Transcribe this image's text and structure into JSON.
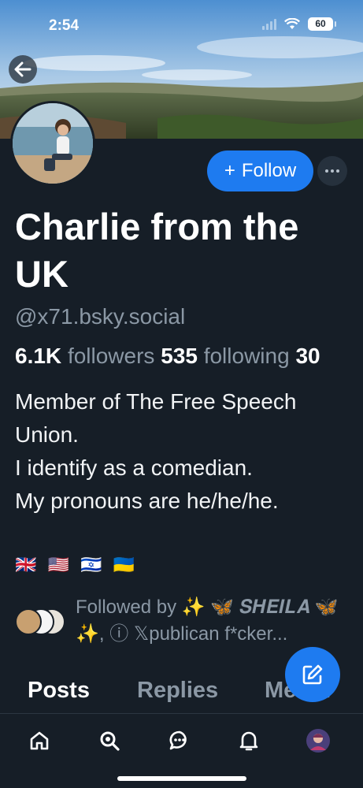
{
  "status_bar": {
    "time": "2:54",
    "battery": "60"
  },
  "profile": {
    "display_name": "Charlie from the UK",
    "handle": "@x71.bsky.social",
    "follow_label": "Follow",
    "stats": {
      "followers_count": "6.1K",
      "followers_label": "followers",
      "following_count": "535",
      "following_label": "following",
      "posts_count": "30"
    },
    "bio": "Member of The Free Speech\nUnion.\nI identify as a comedian.\nMy pronouns are he/he/he.",
    "flags": "🇬🇧 🇺🇸 🇮🇱 🇺🇦",
    "followed_by": "Followed by ✨ 🦋 𝑺𝑯𝑬𝑰𝑳𝑨 🦋 ✨, ⓘ 𝕏publican f*cker..."
  },
  "tabs": [
    {
      "label": "Posts",
      "active": true
    },
    {
      "label": "Replies",
      "active": false
    },
    {
      "label": "Media",
      "active": false
    }
  ],
  "icons": {
    "back": "arrow-left-icon",
    "more": "ellipsis-icon",
    "compose": "pencil-square-icon",
    "nav": [
      "home-icon",
      "search-icon",
      "chat-icon",
      "bell-icon",
      "avatar"
    ]
  },
  "colors": {
    "accent": "#1e7bf0",
    "background": "#161e27",
    "muted": "#8b98a5"
  }
}
